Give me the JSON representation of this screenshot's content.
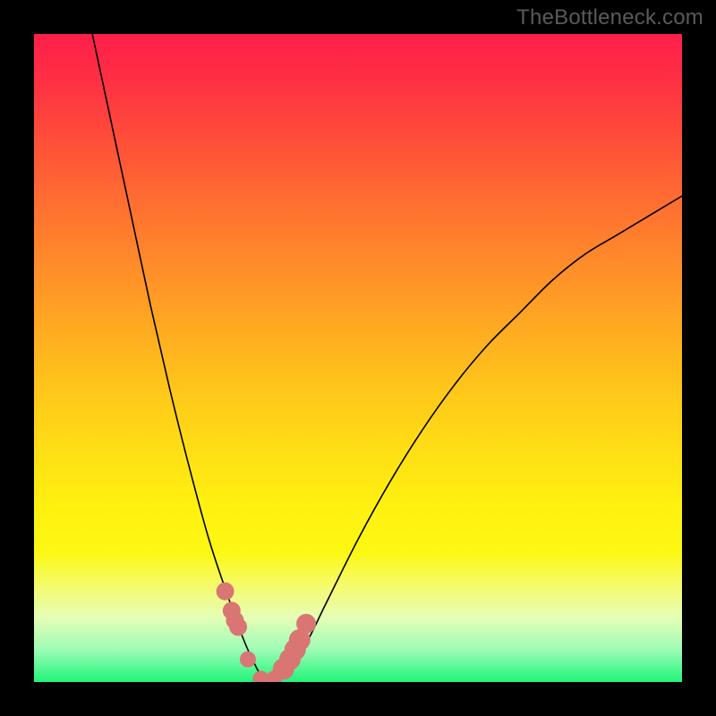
{
  "watermark": "TheBottleneck.com",
  "colors": {
    "gradient_top": "#ff1f4b",
    "gradient_bottom": "#20f57a",
    "curve": "#000000",
    "dots": "#d97673",
    "frame": "#000000"
  },
  "chart_data": {
    "type": "line",
    "title": "",
    "xlabel": "",
    "ylabel": "",
    "xlim": [
      0,
      100
    ],
    "ylim": [
      0,
      100
    ],
    "description": "V-shaped bottleneck curve: y represents bottleneck percentage (0 at bottom = no bottleneck / green, 100 at top = severe bottleneck / red). Minimum sits near x ≈ 36 where y ≈ 0. Left arm rises steeply to ~100 by x ≈ 9; right arm rises asymptotically toward ~75 at x = 100.",
    "series": [
      {
        "name": "bottleneck-curve",
        "x": [
          9,
          12,
          15,
          18,
          21,
          24,
          27,
          30,
          33,
          36,
          39,
          42,
          45,
          50,
          55,
          60,
          65,
          70,
          75,
          80,
          85,
          90,
          95,
          100
        ],
        "y": [
          100,
          86,
          72,
          58,
          45,
          33,
          22,
          13,
          5,
          0,
          2,
          6,
          12,
          22,
          31,
          39,
          46,
          52,
          57,
          62,
          66,
          69,
          72,
          75
        ]
      }
    ],
    "highlight_points": {
      "name": "near-minimum-markers",
      "color": "#d97673",
      "x": [
        29.5,
        30.5,
        31.0,
        31.5,
        33.0,
        35.0,
        37.0,
        38.5,
        39.5,
        40.3,
        41.0,
        42.0
      ],
      "y": [
        14,
        11,
        9.5,
        8.5,
        3.5,
        0.5,
        0.5,
        2.0,
        3.5,
        5.0,
        6.5,
        9.0
      ],
      "r": [
        10,
        10,
        10,
        10,
        9,
        9,
        9,
        12,
        12,
        12,
        12,
        11
      ]
    }
  }
}
